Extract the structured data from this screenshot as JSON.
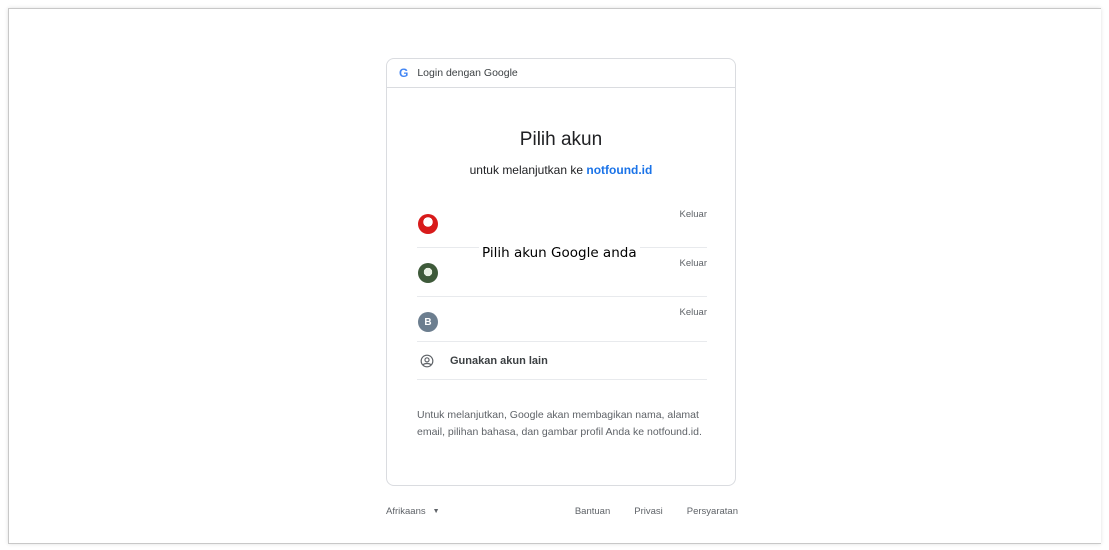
{
  "header": {
    "title": "Login dengan Google",
    "logo": "G"
  },
  "main": {
    "title": "Pilih akun",
    "subtitle_prefix": "untuk melanjutkan ke",
    "subtitle_link": "notfound.id"
  },
  "accounts": [
    {
      "avatar": "avatar-1",
      "signout_label": "Keluar"
    },
    {
      "avatar": "avatar-2",
      "signout_label": "Keluar"
    },
    {
      "avatar_letter": "B",
      "signout_label": "Keluar"
    }
  ],
  "overlay_text": "Pilih akun Google anda",
  "other_account": {
    "label": "Gunakan akun lain",
    "icon": "account-circle-icon"
  },
  "disclaimer": "Untuk melanjutkan, Google akan membagikan nama, alamat email, pilihan bahasa, dan gambar profil Anda ke notfound.id.",
  "footer": {
    "language": "Afrikaans",
    "links": [
      "Bantuan",
      "Privasi",
      "Persyaratan"
    ]
  },
  "colors": {
    "link": "#1a73e8",
    "border": "#dadce0",
    "muted": "#5f6368"
  }
}
